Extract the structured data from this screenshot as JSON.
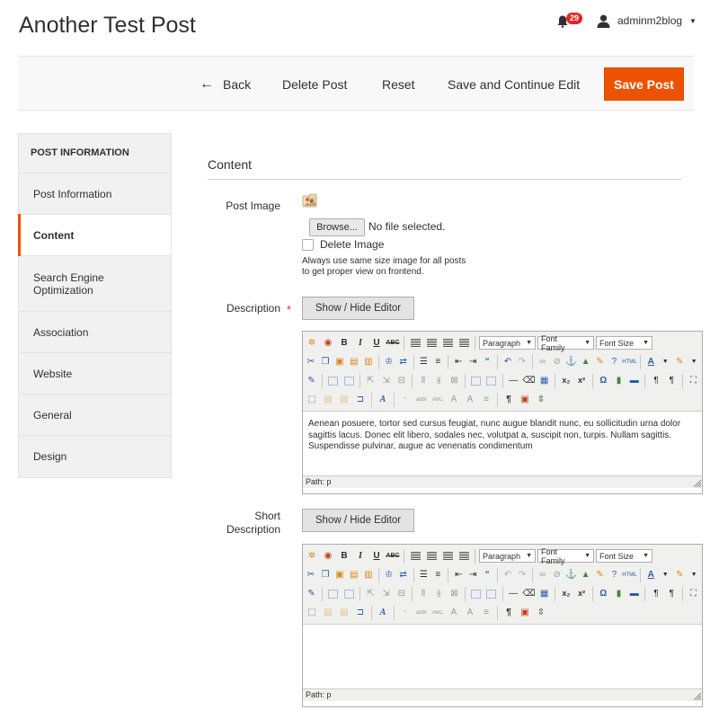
{
  "page": {
    "title": "Another Test Post"
  },
  "header": {
    "notifications_count": "29",
    "user_name": "adminm2blog"
  },
  "actions": {
    "back": "Back",
    "delete": "Delete Post",
    "reset": "Reset",
    "save_continue": "Save and Continue Edit",
    "save": "Save Post"
  },
  "sidebar": {
    "title": "POST INFORMATION",
    "items": [
      {
        "label": "Post Information",
        "active": false
      },
      {
        "label": "Content",
        "active": true
      },
      {
        "label": "Search Engine Optimization",
        "active": false
      },
      {
        "label": "Association",
        "active": false
      },
      {
        "label": "Website",
        "active": false
      },
      {
        "label": "General",
        "active": false
      },
      {
        "label": "Design",
        "active": false
      }
    ]
  },
  "content": {
    "section_title": "Content",
    "post_image": {
      "label": "Post Image",
      "browse_label": "Browse...",
      "file_status": "No file selected.",
      "delete_label": "Delete Image",
      "hint": "Always use same size image for all posts to get proper view on frontend."
    },
    "description": {
      "label": "Description",
      "required_mark": "*",
      "toggle_label": "Show / Hide Editor",
      "text": "Aenean posuere, tortor sed cursus feugiat, nunc augue blandit nunc, eu sollicitudin urna dolor sagittis lacus. Donec elit libero, sodales nec, volutpat a, suscipit non, turpis. Nullam sagittis. Suspendisse pulvinar, augue ac venenatis condimentum",
      "path": "Path: p"
    },
    "short_description": {
      "label_line1": "Short",
      "label_line2": "Description",
      "toggle_label": "Show / Hide Editor",
      "text": "",
      "path": "Path: p"
    }
  },
  "editor_toolbar": {
    "format_select": "Paragraph",
    "font_family_select": "Font Family",
    "font_size_select": "Font Size"
  },
  "colors": {
    "accent": "#eb5202",
    "badge": "#e22626",
    "sidebar_bg": "#f1f1f1",
    "action_bar_bg": "#f8f8f8"
  }
}
